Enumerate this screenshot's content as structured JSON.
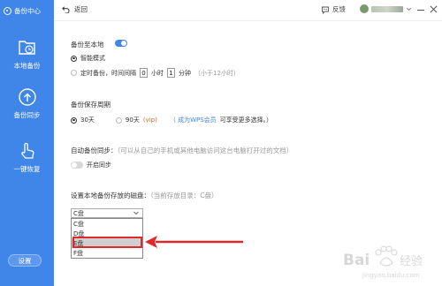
{
  "sidebar": {
    "brand": "备份中心",
    "items": [
      {
        "label": "本地备份",
        "icon": "folder-clock-icon"
      },
      {
        "label": "备份同步",
        "icon": "cloud-upload-icon"
      },
      {
        "label": "一键恢复",
        "icon": "hand-touch-icon"
      }
    ],
    "settings_label": "设置"
  },
  "topbar": {
    "back_label": "返回",
    "feedback_label": "反馈"
  },
  "backup_local": {
    "title": "备份至本地",
    "toggle_on": true,
    "smart_mode_label": "智能模式",
    "timed_label_pre": "定时备份，时间间隔",
    "hours_value": "0",
    "hours_unit": "小时",
    "minutes_value": "1",
    "minutes_unit": "分钟",
    "timed_hint": "（小于12小时）"
  },
  "retention": {
    "title": "备份保存周期",
    "opt30": "30天",
    "opt90": "90天",
    "vip_tag": "(vip)",
    "vip_link": "（ 成为WPS会员",
    "vip_link_suffix": "可享受更多选择。）"
  },
  "auto_sync": {
    "title": "自动备份同步：",
    "hint": "（可以从自己的手机或其他电脑访问这台电脑打开过的文档）",
    "toggle_label": "开启同步",
    "toggle_on": false
  },
  "disk": {
    "title": "设置本地备份存放的磁盘：",
    "current_hint": "（当前存放目录：C盘）",
    "selected": "C盘",
    "options": [
      "C盘",
      "D盘",
      "E盘",
      "F盘"
    ],
    "highlighted_index": 2
  },
  "watermark": {
    "text": "Bai百度 经验",
    "sub": "jingyan.baidu.com"
  },
  "colors": {
    "accent": "#3f86e8",
    "highlight_red": "#e02a2a"
  }
}
